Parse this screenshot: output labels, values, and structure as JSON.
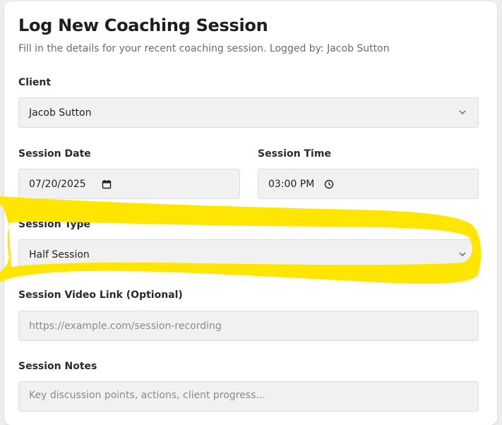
{
  "form": {
    "title": "Log New Coaching Session",
    "subtitle": "Fill in the details for your recent coaching session. Logged by: Jacob Sutton",
    "client": {
      "label": "Client",
      "value": "Jacob Sutton"
    },
    "session_date": {
      "label": "Session Date",
      "value": "07/20/2025"
    },
    "session_time": {
      "label": "Session Time",
      "value": "03:00 PM"
    },
    "session_type": {
      "label": "Session Type",
      "value": "Half Session"
    },
    "video_link": {
      "label": "Session Video Link (Optional)",
      "placeholder": "https://example.com/session-recording"
    },
    "notes": {
      "label": "Session Notes",
      "placeholder": "Key discussion points, actions, client progress..."
    }
  },
  "icons": {
    "select_chevron": "chevron-down-icon",
    "date_picker": "calendar-icon",
    "time_picker": "clock-icon"
  },
  "colors": {
    "highlight": "#FFE600",
    "field_background": "#F1F1F1",
    "card_background": "#FFFFFF"
  }
}
